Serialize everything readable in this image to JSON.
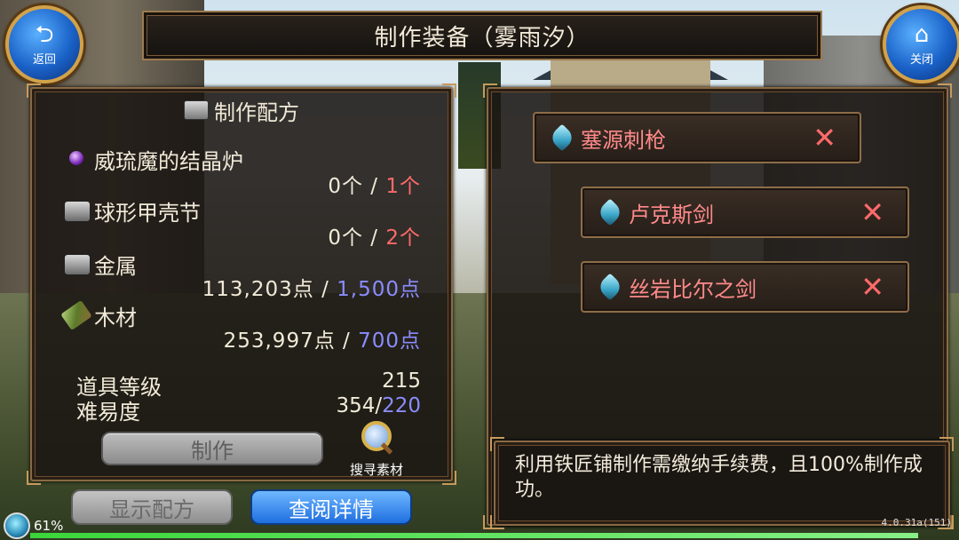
{
  "window": {
    "title": "制作装备（雾雨汐）"
  },
  "nav": {
    "back_label": "返回",
    "close_label": "关闭"
  },
  "recipe": {
    "header": "制作配方",
    "materials": [
      {
        "name": "威琉魔的结晶炉",
        "icon": "crystal-orb-icon",
        "have": "0个",
        "sep": " / ",
        "need": "1个",
        "need_color": "#ff6a6a"
      },
      {
        "name": "球形甲壳节",
        "icon": "shell-icon",
        "have": "0个",
        "sep": " / ",
        "need": "2个",
        "need_color": "#ff6a6a"
      },
      {
        "name": "金属",
        "icon": "metal-icon",
        "have": "113,203点",
        "sep": " / ",
        "need": "1,500点",
        "need_color": "#8a8cff"
      },
      {
        "name": "木材",
        "icon": "wood-icon",
        "have": "253,997点",
        "sep": " / ",
        "need": "700点",
        "need_color": "#8a8cff"
      }
    ],
    "item_level_label": "道具等级",
    "item_level_value": "215",
    "difficulty_label": "难易度",
    "difficulty_have": "354/",
    "difficulty_need": "220",
    "craft_label": "制作",
    "search_label": "搜寻素材"
  },
  "buttons": {
    "show_recipe": "显示配方",
    "view_details": "查阅详情"
  },
  "equipment": [
    {
      "name": "塞源刺枪",
      "remove": "✕"
    },
    {
      "name": "卢克斯剑",
      "remove": "✕"
    },
    {
      "name": "丝岩比尔之剑",
      "remove": "✕"
    }
  ],
  "info": {
    "text": "利用铁匠铺制作需缴纳手续费，且100%制作成功。"
  },
  "status": {
    "battery": "61%",
    "version": "4.0.31a(151)"
  }
}
